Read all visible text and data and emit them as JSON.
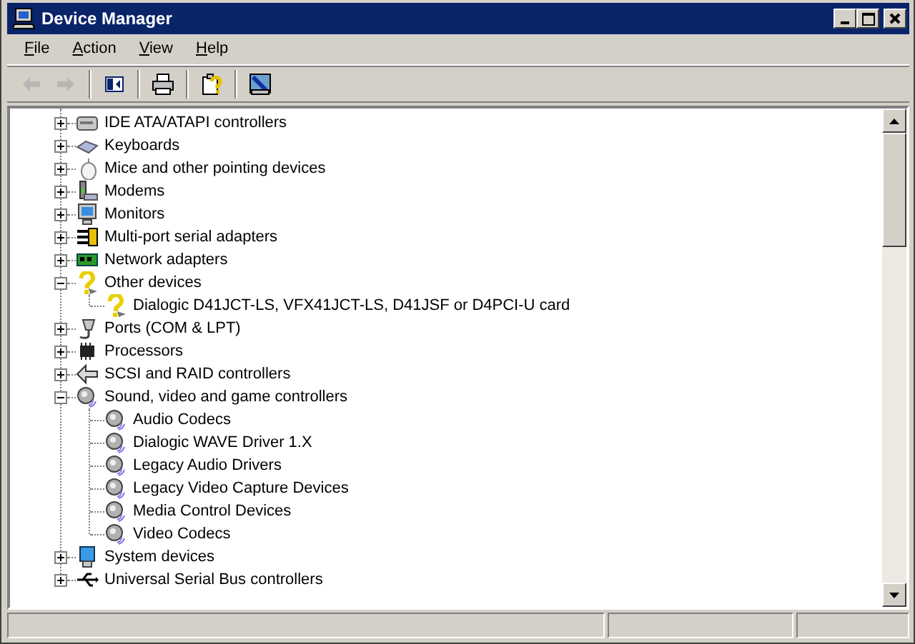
{
  "window": {
    "title": "Device Manager"
  },
  "menu": [
    {
      "label": "File"
    },
    {
      "label": "Action"
    },
    {
      "label": "View"
    },
    {
      "label": "Help"
    }
  ],
  "toolbar": [
    {
      "kind": "back",
      "disabled": true
    },
    {
      "kind": "forward",
      "disabled": true
    },
    {
      "kind": "tree",
      "disabled": false
    },
    {
      "kind": "print",
      "disabled": false
    },
    {
      "kind": "properties",
      "disabled": false
    },
    {
      "kind": "scan",
      "disabled": false
    }
  ],
  "tree": [
    {
      "label": "IDE ATA/ATAPI controllers",
      "expanded": false
    },
    {
      "label": "Keyboards",
      "expanded": false
    },
    {
      "label": "Mice and other pointing devices",
      "expanded": false
    },
    {
      "label": "Modems",
      "expanded": false
    },
    {
      "label": "Monitors",
      "expanded": false
    },
    {
      "label": "Multi-port serial adapters",
      "expanded": false
    },
    {
      "label": "Network adapters",
      "expanded": false
    },
    {
      "label": "Other devices",
      "expanded": true,
      "children": [
        {
          "label": "Dialogic D41JCT-LS, VFX41JCT-LS, D41JSF or D4PCI-U card"
        }
      ]
    },
    {
      "label": "Ports (COM & LPT)",
      "expanded": false
    },
    {
      "label": "Processors",
      "expanded": false
    },
    {
      "label": "SCSI and RAID controllers",
      "expanded": false
    },
    {
      "label": "Sound, video and game controllers",
      "expanded": true,
      "children": [
        {
          "label": "Audio Codecs"
        },
        {
          "label": "Dialogic WAVE Driver 1.X"
        },
        {
          "label": "Legacy Audio Drivers"
        },
        {
          "label": "Legacy Video Capture Devices"
        },
        {
          "label": "Media Control Devices"
        },
        {
          "label": "Video Codecs"
        }
      ]
    },
    {
      "label": "System devices",
      "expanded": false
    },
    {
      "label": "Universal Serial Bus controllers",
      "expanded": false
    }
  ]
}
